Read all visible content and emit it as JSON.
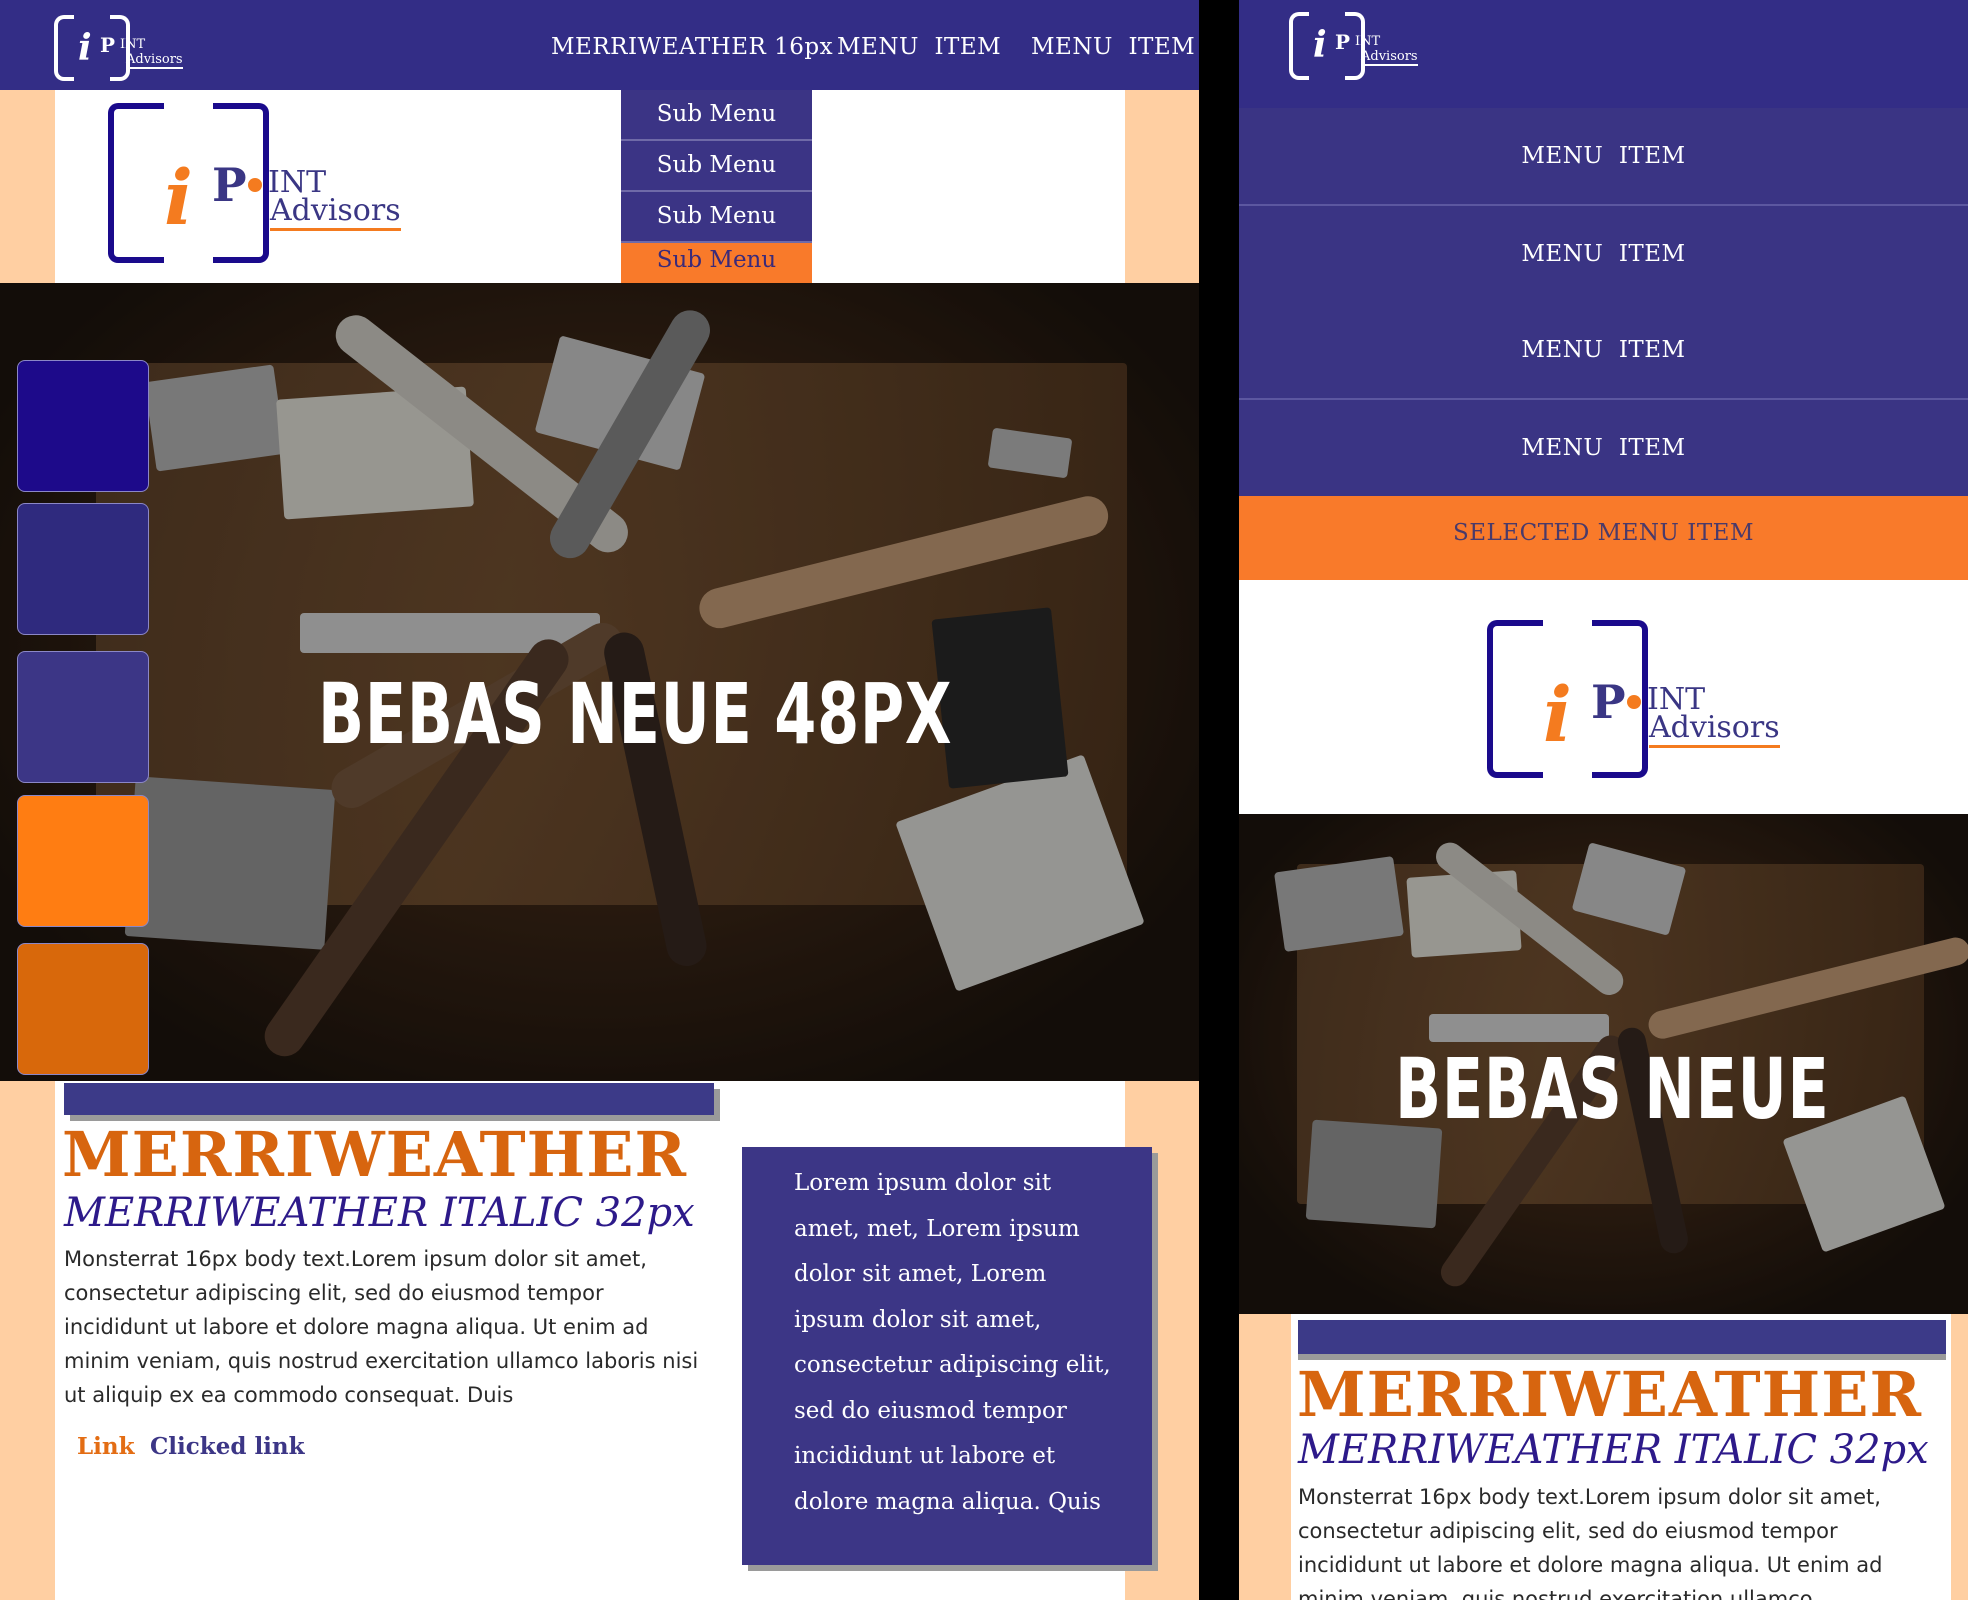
{
  "colors": {
    "navy": "#332d86",
    "orange": "#f97a2a",
    "peach": "#ffcfa2",
    "deep_purple": "#1d0a8a"
  },
  "logo": {
    "i": "i",
    "p": "P",
    "int": "INT",
    "advisors": "Advisors"
  },
  "desktop": {
    "nav": {
      "item1": "MERRIWEATHER 16px",
      "item2": "MENU  ITEM",
      "item3": "MENU  ITEM"
    },
    "submenu": [
      "Sub Menu",
      "Sub Menu",
      "Sub Menu",
      "Sub Menu"
    ],
    "hero_title": "BEBAS NEUE 48PX",
    "swatches": [
      "#1d0a8a",
      "#2f2a7e",
      "#3c3686",
      "#ff7d12",
      "#d8680b"
    ],
    "heading": "MERRIWEATHER",
    "subheading": "MERRIWEATHER ITALIC 32px",
    "body": "Monsterrat 16px body text.Lorem ipsum dolor sit amet, consectetur adipiscing elit, sed do eiusmod tempor incididunt ut labore et dolore magna aliqua. Ut enim ad minim veniam, quis nostrud exercitation ullamco laboris nisi ut aliquip ex ea commodo consequat. Duis",
    "link": "Link",
    "clicked_link": "Clicked link",
    "card_text": "Lorem ipsum dolor sit amet, met, Lorem ipsum dolor sit amet, Lorem ipsum dolor sit amet, consectetur adipiscing elit, sed do eiusmod tempor incididunt ut labore et dolore magna aliqua. Quis"
  },
  "mobile": {
    "menu": [
      "MENU  ITEM",
      "MENU  ITEM",
      "MENU  ITEM",
      "MENU  ITEM"
    ],
    "selected": "SELECTED MENU ITEM",
    "hero_title": "BEBAS NEUE",
    "heading": "MERRIWEATHER",
    "subheading": "MERRIWEATHER ITALIC 32px",
    "body": "Monsterrat 16px body text.Lorem ipsum dolor sit amet, consectetur adipiscing elit, sed do eiusmod tempor incididunt ut labore et dolore magna aliqua. Ut enim ad minim veniam, quis nostrud exercitation ullamco"
  }
}
